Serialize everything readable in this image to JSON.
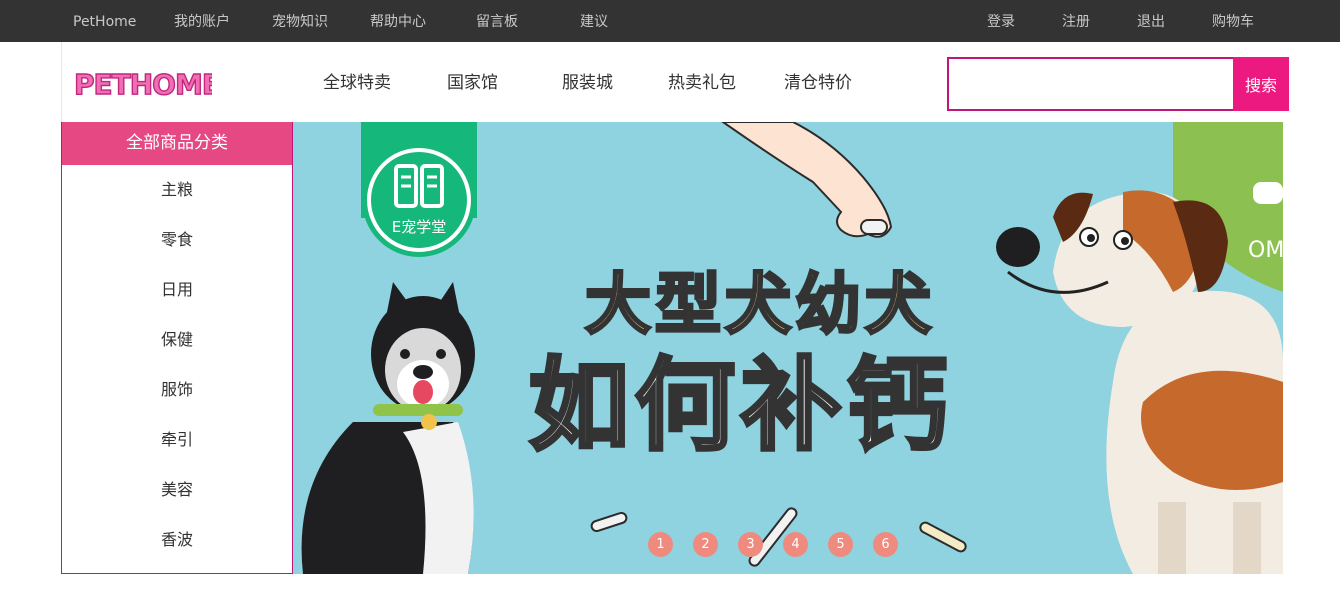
{
  "topbar": {
    "left_links": [
      "PetHome",
      "我的账户",
      "宠物知识",
      "帮助中心",
      "留言板",
      "建议"
    ],
    "right_links": [
      "登录",
      "注册",
      "退出",
      "购物车"
    ]
  },
  "logo": {
    "text": "PETHOME"
  },
  "main_nav": [
    "全球特卖",
    "国家馆",
    "服装城",
    "热卖礼包",
    "清仓特价"
  ],
  "search": {
    "value": "",
    "placeholder": "",
    "button_label": "搜索"
  },
  "category": {
    "title": "全部商品分类",
    "items": [
      "主粮",
      "零食",
      "日用",
      "保健",
      "服饰",
      "牵引",
      "美容",
      "香波"
    ]
  },
  "banner": {
    "badge_text": "E宠学堂",
    "headline_line1": "大型犬幼犬",
    "headline_line2": "如何补钙",
    "side_text": "OM-",
    "slides": [
      "1",
      "2",
      "3",
      "4",
      "5",
      "6"
    ]
  },
  "colors": {
    "topbar_bg": "#333333",
    "accent_pink": "#ec1a80",
    "category_title_bg": "#e54883",
    "banner_bg": "#8fd2e0",
    "slide_dot": "#ef8a7f",
    "badge_green": "#16b77a"
  }
}
